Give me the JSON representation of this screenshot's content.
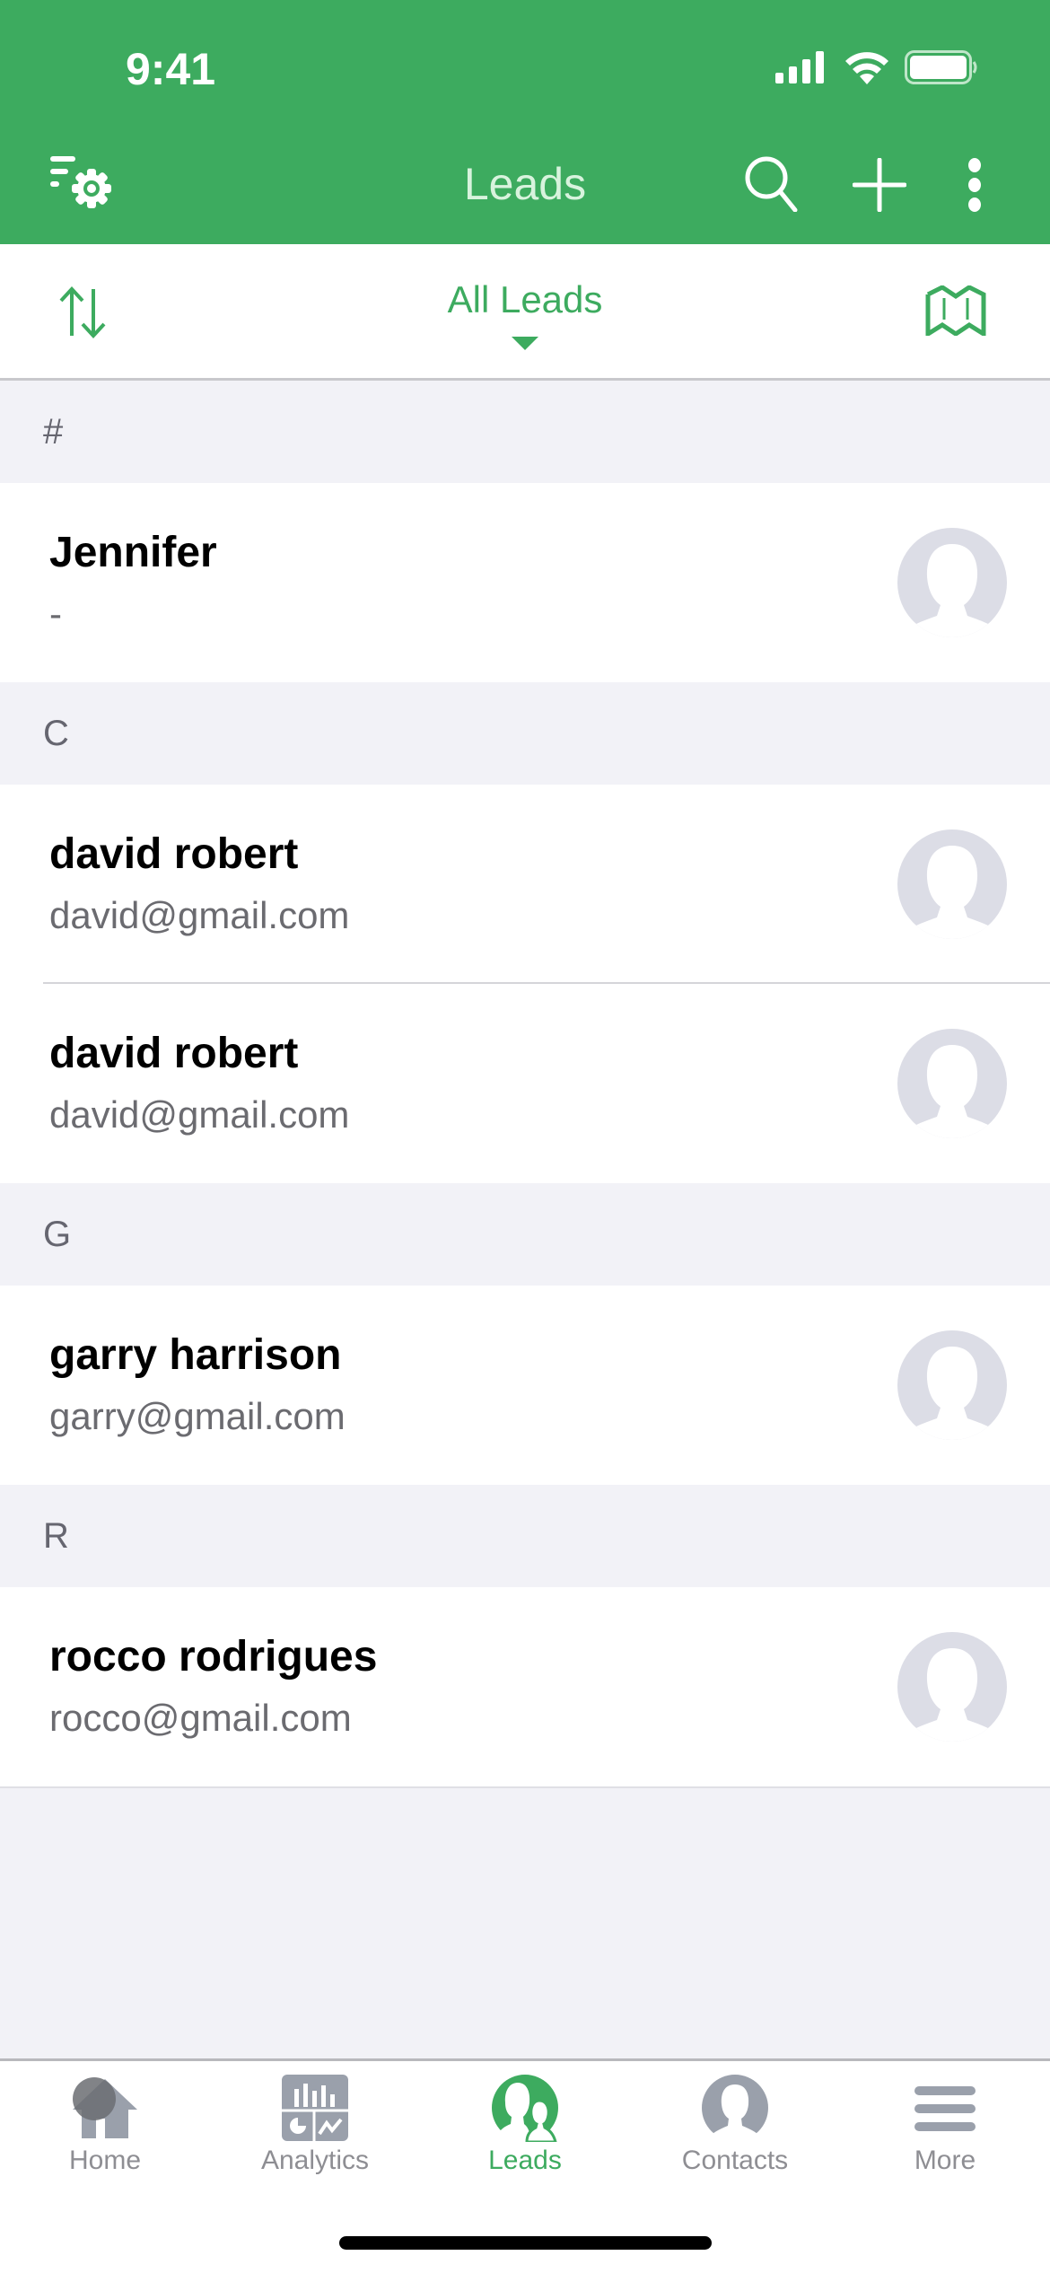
{
  "status_bar": {
    "time": "9:41"
  },
  "nav": {
    "title": "Leads",
    "icons": [
      "filter-settings-icon",
      "search-icon",
      "plus-icon",
      "more-vertical-icon"
    ]
  },
  "subheader": {
    "filter_label": "All Leads",
    "left_icon": "sort-icon",
    "right_icon": "map-icon"
  },
  "sections": [
    {
      "letter": "#",
      "items": [
        {
          "name": "Jennifer",
          "sub": "-"
        }
      ]
    },
    {
      "letter": "C",
      "items": [
        {
          "name": "david robert",
          "sub": "david@gmail.com"
        },
        {
          "name": "david robert",
          "sub": "david@gmail.com"
        }
      ]
    },
    {
      "letter": "G",
      "items": [
        {
          "name": "garry harrison",
          "sub": "garry@gmail.com"
        }
      ]
    },
    {
      "letter": "R",
      "items": [
        {
          "name": "rocco rodrigues",
          "sub": "rocco@gmail.com"
        }
      ]
    }
  ],
  "tabbar": {
    "active": "Leads",
    "tabs": [
      {
        "label": "Home",
        "icon": "home-icon"
      },
      {
        "label": "Analytics",
        "icon": "analytics-icon"
      },
      {
        "label": "Leads",
        "icon": "leads-icon"
      },
      {
        "label": "Contacts",
        "icon": "contacts-icon"
      },
      {
        "label": "More",
        "icon": "menu-icon"
      }
    ]
  },
  "colors": {
    "brand_green": "#3dab5f",
    "title_tint": "#d8f3dd",
    "inactive_gray": "#8e8e93",
    "background": "#f2f2f7"
  }
}
